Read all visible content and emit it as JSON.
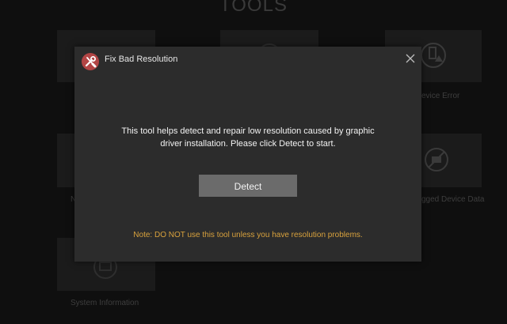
{
  "background": {
    "page_title": "TOOLS",
    "tiles": [
      {
        "label": "",
        "icon": "blank-icon"
      },
      {
        "label": "",
        "icon": "blank-icon"
      },
      {
        "label": "evice Error",
        "icon": "device-error-icon"
      },
      {
        "label": "N",
        "icon": "blank-icon"
      },
      {
        "label": "gged Device Data",
        "icon": "no-device-icon"
      },
      {
        "label": "System Information",
        "icon": "system-info-icon"
      }
    ]
  },
  "dialog": {
    "title": "Fix Bad Resolution",
    "app_icon": "tools-icon",
    "close_icon": "close-icon",
    "message_line1": "This tool helps detect and repair low resolution caused by graphic",
    "message_line2": "driver installation. Please click Detect to start.",
    "detect_label": "Detect",
    "note": "Note: DO NOT use this tool unless you have resolution problems.",
    "note_color": "#d9a23d"
  }
}
